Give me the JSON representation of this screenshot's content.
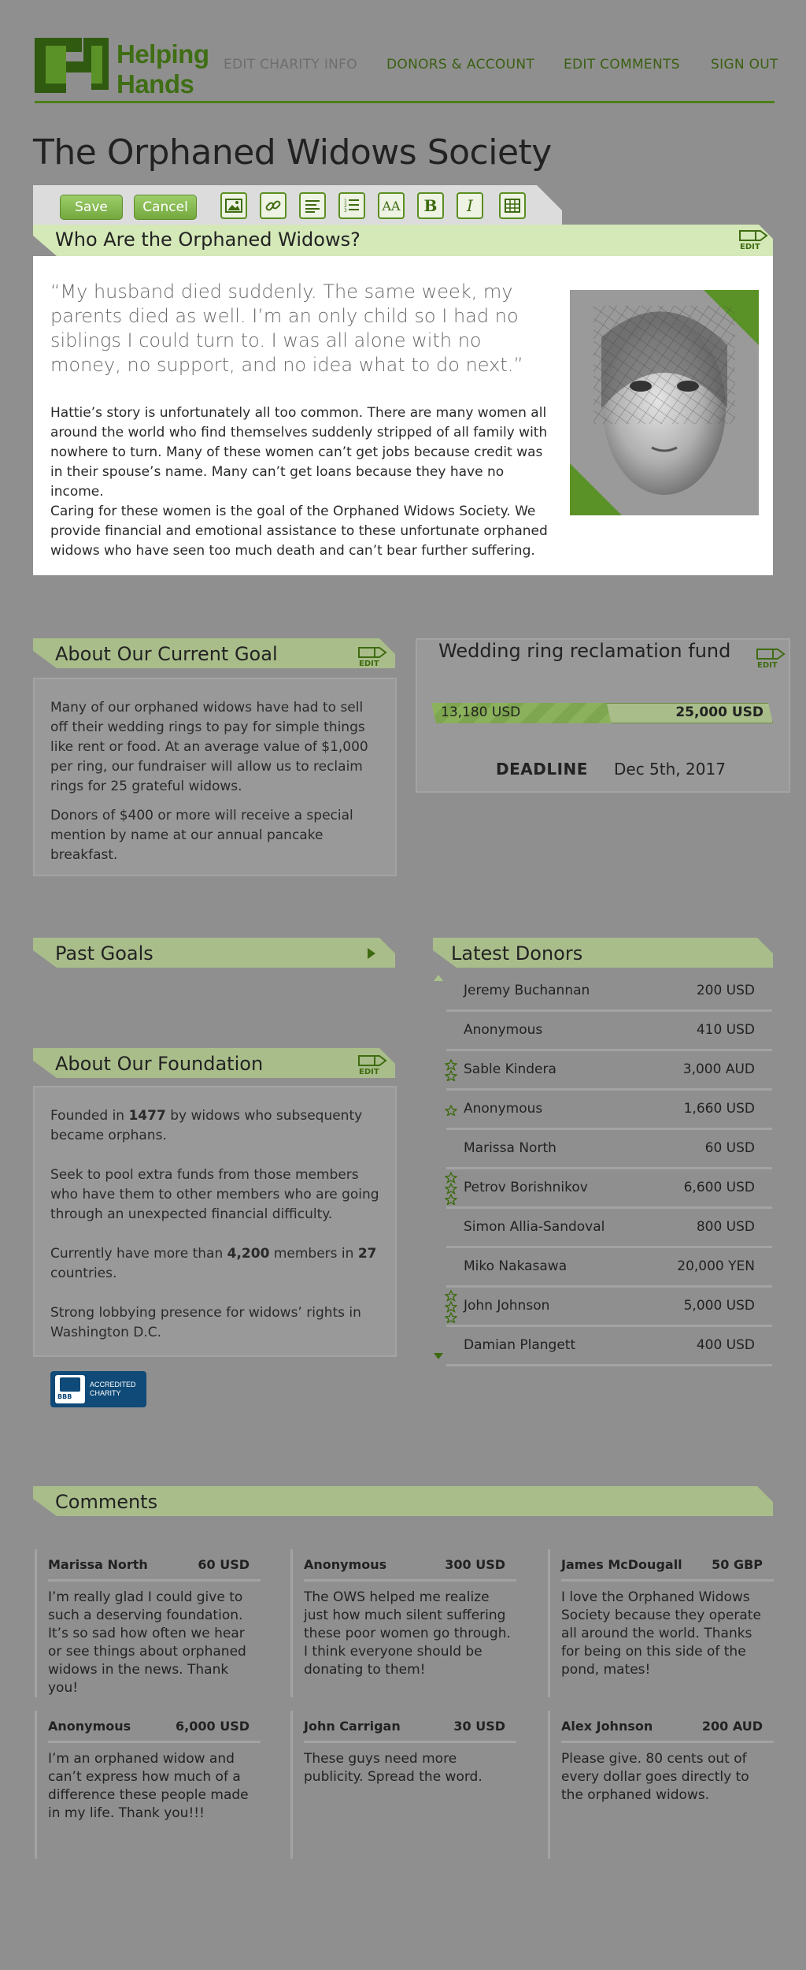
{
  "header": {
    "logo_text_line1": "Helping",
    "logo_text_line2": "Hands",
    "nav": [
      "EDIT CHARITY INFO",
      "DONORS & ACCOUNT",
      "EDIT COMMENTS",
      "SIGN OUT"
    ]
  },
  "page_title": "The Orphaned Widows Society",
  "toolbar": {
    "save_label": "Save",
    "cancel_label": "Cancel",
    "tools": [
      "image-icon",
      "link-icon",
      "align-icon",
      "numbered-list-icon",
      "font-size-icon",
      "bold-icon",
      "italic-icon",
      "table-icon"
    ],
    "font_size_glyph": "AA",
    "bold_glyph": "B",
    "italic_glyph": "I"
  },
  "edit_label": "EDIT",
  "who": {
    "title": "Who Are the Orphaned Widows?",
    "quote": "“My husband died suddenly. The same week, my parents died as well. I’m an only child so I had no siblings I could turn to. I was all alone with no money, no support, and no idea what to do next.”",
    "p1": "Hattie’s story is unfortunately all too common. There are many women all around the world who find themselves suddenly stripped of all family with nowhere to turn. Many of these women can’t get jobs because credit was in their spouse’s name. Many can’t get loans because they have no income.",
    "p2": "Caring for these women is the goal of the Orphaned Widows Society. We provide financial and emotional assistance to these unfortunate orphaned widows who have seen too much death and can’t bear further suffering."
  },
  "goal": {
    "title": "About Our Current Goal",
    "p1": "Many of our orphaned widows have had to sell off their wedding rings to pay for simple things like rent or food. At an average value of $1,000 per ring, our fundraiser will allow us to reclaim rings for 25 grateful widows.",
    "p2": "Donors of $400 or more will receive a special mention by name at our annual pancake breakfast."
  },
  "fund": {
    "title": "Wedding ring reclamation fund",
    "raised_label": "13,180 USD",
    "target_label": "25,000 USD",
    "progress_fraction": 0.527,
    "deadline_label": "DEADLINE",
    "deadline_value": "Dec 5th, 2017"
  },
  "past_goals": {
    "title": "Past Goals"
  },
  "foundation": {
    "title": "About Our Foundation",
    "p1_pre": "Founded in ",
    "p1_bold": "1477",
    "p1_post": " by widows who subsequenty became orphans.",
    "p2": "Seek to pool extra funds from those members who have them to other members who are going through an unexpected financial difficulty.",
    "p3_pre": "Currently have more than ",
    "p3_bold1": "4,200",
    "p3_mid": " members in ",
    "p3_bold2": "27",
    "p3_post": " countries.",
    "p4": "Strong lobbying presence for widows’ rights in Washington D.C.",
    "badge_line1": "ACCREDITED",
    "badge_line2": "CHARITY",
    "badge_logo": "BBB"
  },
  "donors": {
    "title": "Latest Donors",
    "items": [
      {
        "name": "Jeremy Buchannan",
        "amount": "200 USD",
        "stars": 0
      },
      {
        "name": "Anonymous",
        "amount": "410 USD",
        "stars": 0
      },
      {
        "name": "Sable Kindera",
        "amount": "3,000 AUD",
        "stars": 2
      },
      {
        "name": "Anonymous",
        "amount": "1,660 USD",
        "stars": 1
      },
      {
        "name": "Marissa North",
        "amount": "60 USD",
        "stars": 0
      },
      {
        "name": "Petrov Borishnikov",
        "amount": "6,600 USD",
        "stars": 3
      },
      {
        "name": "Simon Allia-Sandoval",
        "amount": "800 USD",
        "stars": 0
      },
      {
        "name": "Miko Nakasawa",
        "amount": "20,000 YEN",
        "stars": 0
      },
      {
        "name": "John Johnson",
        "amount": "5,000 USD",
        "stars": 3
      },
      {
        "name": "Damian Plangett",
        "amount": "400 USD",
        "stars": 0
      }
    ]
  },
  "comments": {
    "title": "Comments",
    "items": [
      {
        "name": "Marissa North",
        "amount": "60 USD",
        "text": "I’m really glad I could give to such a deserving foundation. It’s so sad how often we hear or see things about orphaned widows in the news. Thank you!"
      },
      {
        "name": "Anonymous",
        "amount": "300 USD",
        "text": "The OWS helped me realize just how much silent suffering these poor women go through. I think everyone should be donating to them!"
      },
      {
        "name": "James McDougall",
        "amount": "50 GBP",
        "text": "I love the Orphaned Widows Society because they operate all around the world. Thanks for being on this side of the pond, mates!"
      },
      {
        "name": "Anonymous",
        "amount": "6,000 USD",
        "text": "I’m an orphaned widow and can’t express how much of a difference these people made in my life. Thank you!!!"
      },
      {
        "name": "John Carrigan",
        "amount": "30 USD",
        "text": "These guys need more publicity. Spread the word."
      },
      {
        "name": "Alex Johnson",
        "amount": "200 AUD",
        "text": "Please give. 80 cents out of every dollar goes directly to the orphaned widows."
      }
    ]
  },
  "colors": {
    "brand_green": "#3f6e14",
    "accent_green": "#a9bd8a",
    "light_green": "#d4e8b8",
    "background": "#8f8f8f"
  }
}
